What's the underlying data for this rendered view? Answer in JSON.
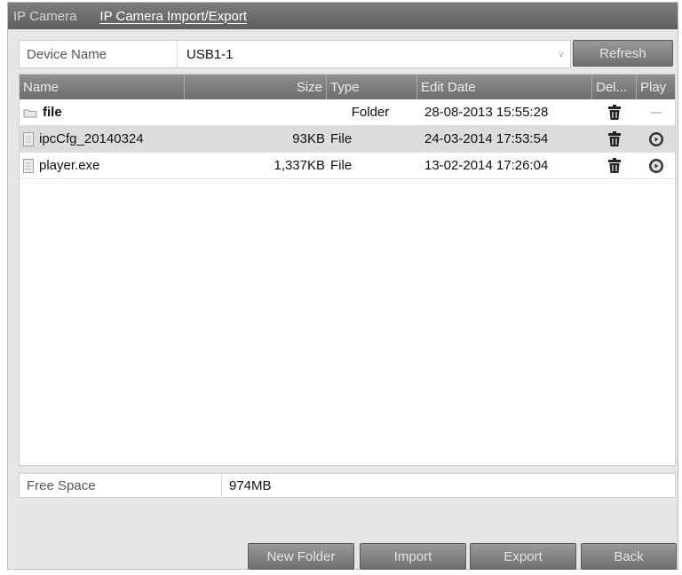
{
  "tabs": [
    {
      "label": "IP Camera",
      "active": false
    },
    {
      "label": "IP Camera Import/Export",
      "active": true
    }
  ],
  "device": {
    "label": "Device Name",
    "value": "USB1-1",
    "refresh_label": "Refresh"
  },
  "table": {
    "columns": [
      "Name",
      "Size",
      "Type",
      "Edit Date",
      "Del...",
      "Play"
    ],
    "rows": [
      {
        "name": "file",
        "size": "",
        "type": "Folder",
        "date": "28-08-2013 15:55:28",
        "icon": "folder-icon",
        "play": "none"
      },
      {
        "name": "ipcCfg_20140324",
        "size": "93KB",
        "type": "File",
        "date": "24-03-2014 17:53:54",
        "icon": "file-icon",
        "play": "play-icon",
        "selected": true
      },
      {
        "name": "player.exe",
        "size": "1,337KB",
        "type": "File",
        "date": "13-02-2014 17:26:04",
        "icon": "file-icon",
        "play": "play-icon"
      }
    ]
  },
  "free_space": {
    "label": "Free Space",
    "value": "974MB"
  },
  "buttons": {
    "new_folder": "New Folder",
    "import": "Import",
    "export": "Export",
    "back": "Back"
  }
}
